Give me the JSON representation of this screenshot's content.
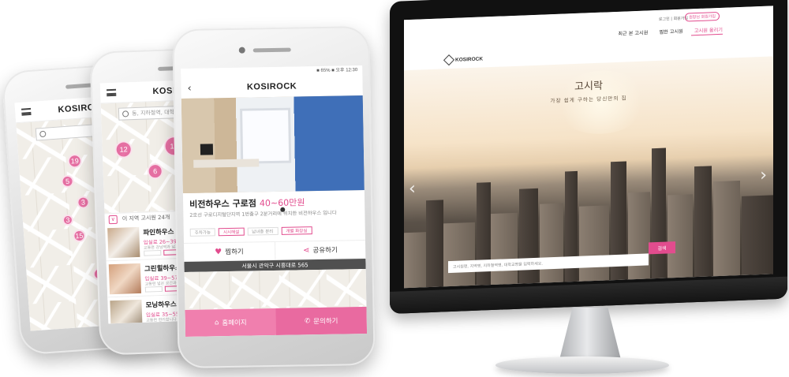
{
  "brand": {
    "logo": "KOSIROCK",
    "accent": "#e24c8e"
  },
  "phone1": {
    "pins": [
      "19",
      "5",
      "3",
      "3",
      "15",
      "5",
      "14"
    ]
  },
  "phone2": {
    "search_placeholder": "동, 지하철역, 대학교 명을 입력",
    "pins": [
      "12",
      "12",
      "6",
      "3"
    ],
    "list_header": "이 지역 고시원 24개",
    "listings": [
      {
        "name": "파인하우스 강남역",
        "price": "입실료 26~39만원",
        "sub": "교통편 강남역과 넓고 편리합니다"
      },
      {
        "name": "그린힐하우스 강",
        "price": "입실료 39~57만원",
        "sub": "교통편 넓은 공간과 편리합니다"
      },
      {
        "name": "모닝하우스 강남",
        "price": "입실료 35~55만원",
        "sub": "교통편 편리합니다"
      }
    ]
  },
  "phone3": {
    "status": "■ 65% ■ 오후 12:30",
    "title": "비전하우스 구로점",
    "price": "40~60만원",
    "address": "2호선 구로디지털단지역 1번출구 2분거리에 위치한 비전하우스 입니다",
    "tags": [
      "주차가능",
      "시시해설",
      "남녀층 분리",
      "개별 화장실"
    ],
    "actions": {
      "like": "찜하기",
      "share": "공유하기"
    },
    "location": "서울시 관악구 시흥대로 565",
    "bottom": {
      "home": "홈페이지",
      "contact": "문의하기"
    }
  },
  "website": {
    "util_links": "로그인 | 회원가입",
    "register_button": "원장님 회원가입",
    "nav": [
      "최근 본 고시원",
      "찜한 고시원",
      "고시원 올리기"
    ],
    "nav_active": 2,
    "hero_title": "고시락",
    "hero_subtitle": "가장 쉽게 구하는 당신만의 집",
    "search_placeholder": "고시원명, 지역명, 지하철역명, 대학교명을 입력하세요.",
    "search_button": "검색"
  }
}
